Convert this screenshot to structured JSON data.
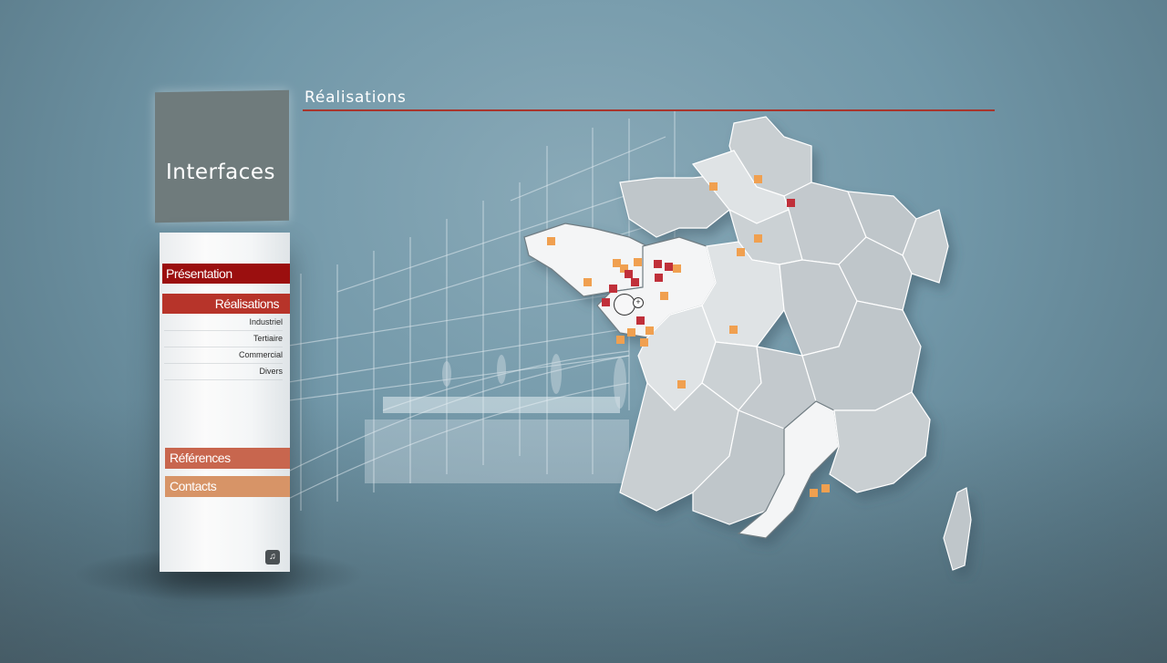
{
  "brand": {
    "name": "Interfaces"
  },
  "page": {
    "title": "Réalisations"
  },
  "menu": {
    "presentation": "Présentation",
    "realisations": "Réalisations",
    "sub_items": [
      "Industriel",
      "Tertiaire",
      "Commercial",
      "Divers"
    ],
    "references": "Références",
    "contacts": "Contacts",
    "sound_icon": "speaker-icon"
  },
  "colors": {
    "accent_dark": "#9b0f0f",
    "accent": "#b7342a",
    "references": "#c8664e",
    "contacts": "#d79467",
    "marker_orange": "#f0a050",
    "marker_red": "#c0303a"
  },
  "map": {
    "icon": "zoom-in-icon",
    "markers": [
      {
        "type": "orange",
        "region": "brittany-west"
      },
      {
        "type": "orange",
        "region": "brittany-south"
      },
      {
        "type": "red",
        "region": "pays-de-la-loire"
      },
      {
        "type": "orange",
        "region": "pays-de-la-loire"
      },
      {
        "type": "red",
        "region": "pays-de-la-loire"
      },
      {
        "type": "orange",
        "region": "picardie"
      },
      {
        "type": "red",
        "region": "picardie"
      },
      {
        "type": "orange",
        "region": "normandie"
      },
      {
        "type": "orange",
        "region": "ile-de-france"
      },
      {
        "type": "orange",
        "region": "centre"
      },
      {
        "type": "orange",
        "region": "limousin"
      },
      {
        "type": "orange",
        "region": "paca"
      }
    ]
  }
}
